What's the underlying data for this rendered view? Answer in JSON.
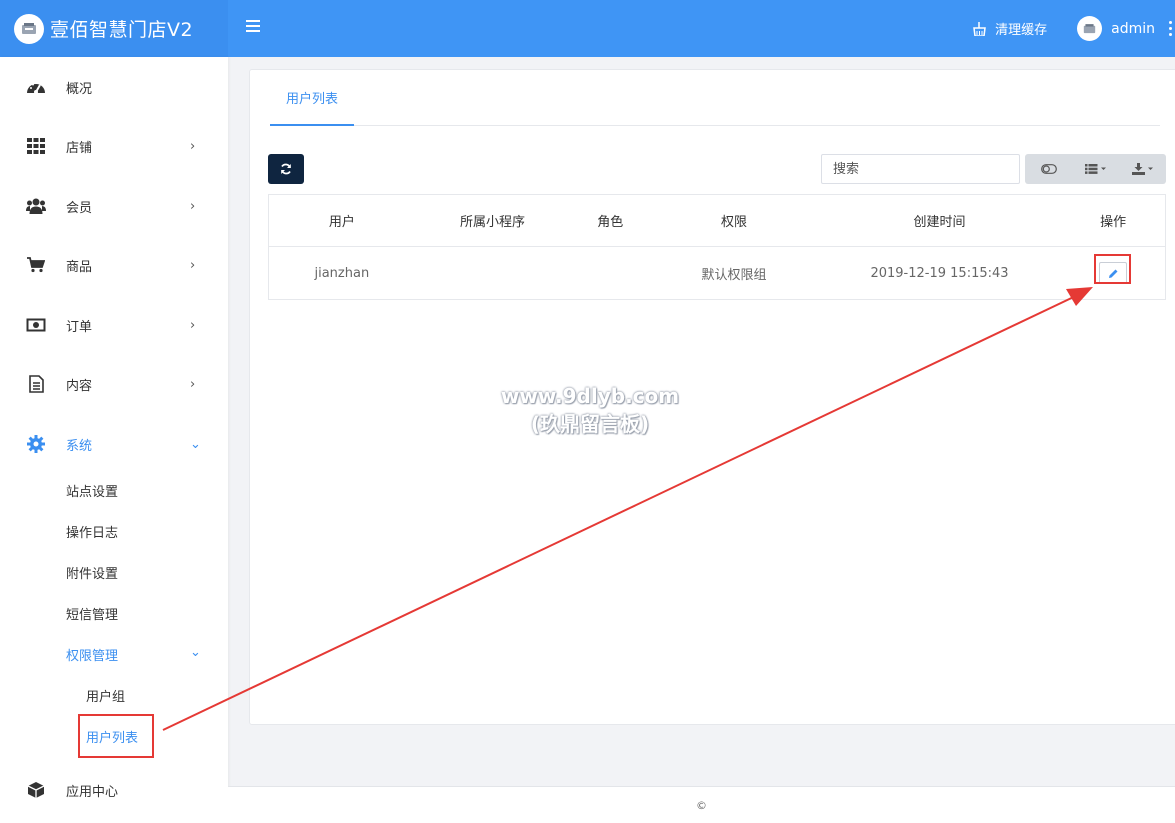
{
  "header": {
    "app_title": "壹佰智慧门店V2",
    "clear_cache_label": "清理缓存",
    "username": "admin"
  },
  "sidebar": {
    "items": [
      {
        "label": "概况",
        "icon": "dashboard-icon"
      },
      {
        "label": "店铺",
        "icon": "grid-icon"
      },
      {
        "label": "会员",
        "icon": "users-icon"
      },
      {
        "label": "商品",
        "icon": "cart-icon"
      },
      {
        "label": "订单",
        "icon": "money-icon"
      },
      {
        "label": "内容",
        "icon": "document-icon"
      },
      {
        "label": "系统",
        "icon": "gear-icon"
      },
      {
        "label": "应用中心",
        "icon": "box-icon"
      }
    ],
    "system_sub": [
      "站点设置",
      "操作日志",
      "附件设置",
      "短信管理",
      "权限管理"
    ],
    "permission_sub": [
      "用户组",
      "用户列表"
    ]
  },
  "main": {
    "tab_label": "用户列表",
    "search_placeholder": "搜索",
    "table": {
      "headers": [
        "用户",
        "所属小程序",
        "角色",
        "权限",
        "创建时间",
        "操作"
      ],
      "rows": [
        {
          "user": "jianzhan",
          "miniprogram": "",
          "role": "",
          "permission": "默认权限组",
          "created": "2019-12-19 15:15:43"
        }
      ]
    }
  },
  "footer": {
    "text": "©"
  },
  "watermark": {
    "line1": "www.9dlyb.com",
    "line2": "(玖鼎留言板)"
  },
  "colors": {
    "accent": "#3b8ff0",
    "annotation": "#e53935",
    "refresh_button": "#0f2540"
  }
}
